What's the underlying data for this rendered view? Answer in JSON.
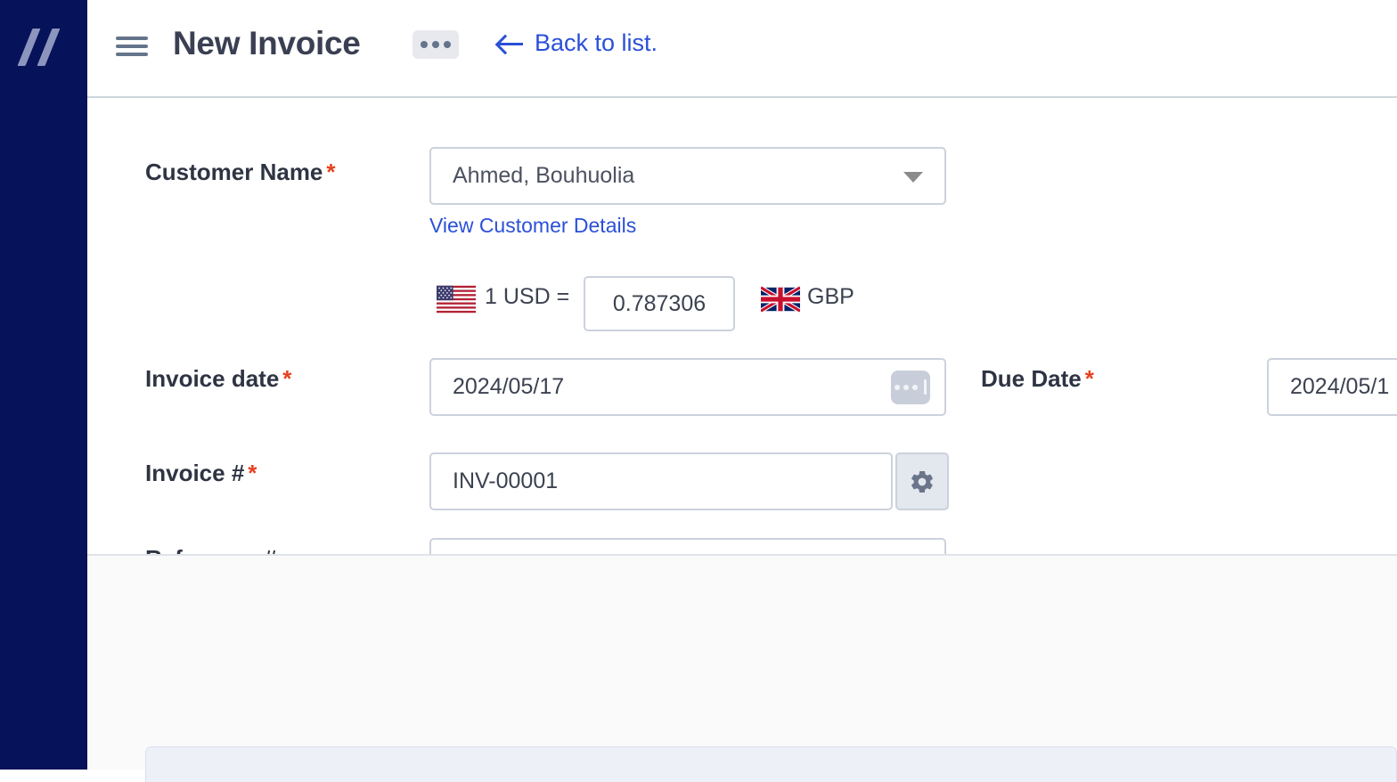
{
  "app": {
    "logo_name": "brand-logo",
    "sidebar_color": "#061259",
    "accent_color": "#2b50d8",
    "required_color": "#e8401f"
  },
  "header": {
    "menu_icon": "hamburger-icon",
    "title": "New Invoice",
    "more_icon": "ellipsis-icon",
    "back_link": "Back to list.",
    "back_icon": "arrow-left-icon"
  },
  "form": {
    "customer": {
      "label": "Customer Name",
      "required": "*",
      "value": "Ahmed, Bouhuolia",
      "caret_icon": "chevron-down-icon",
      "details_link": "View Customer Details"
    },
    "currency": {
      "from_flag": "us-flag-icon",
      "from_text": "1 USD =",
      "rate": "0.787306",
      "to_flag": "gb-flag-icon",
      "to_text": "GBP"
    },
    "invoice_date": {
      "label": "Invoice date",
      "required": "*",
      "value": "2024/05/17",
      "picker_icon": "date-picker-icon"
    },
    "due_date": {
      "label": "Due Date",
      "required": "*",
      "value": "2024/05/1"
    },
    "invoice_number": {
      "label": "Invoice #",
      "required": "*",
      "value": "INV-00001",
      "settings_icon": "gear-icon"
    },
    "reference": {
      "label": "Reference #",
      "required": "",
      "value": "",
      "placeholder": ""
    }
  }
}
